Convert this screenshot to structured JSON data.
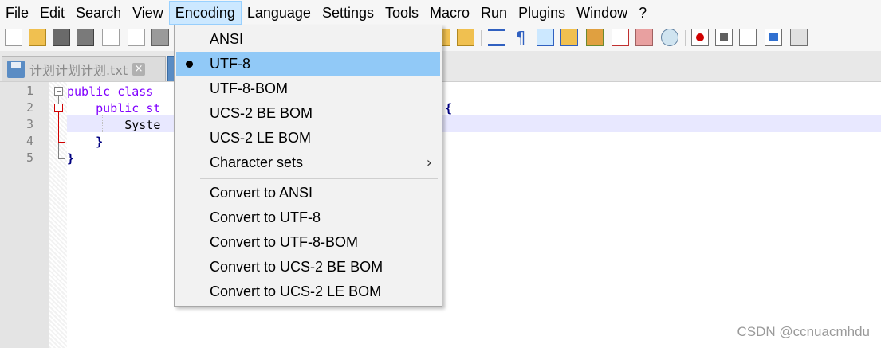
{
  "menubar": {
    "items": [
      "File",
      "Edit",
      "Search",
      "View",
      "Encoding",
      "Language",
      "Settings",
      "Tools",
      "Macro",
      "Run",
      "Plugins",
      "Window",
      "?"
    ],
    "active_index": 4
  },
  "tabs": [
    {
      "label": "计划计划计划.txt",
      "active": false
    }
  ],
  "editor": {
    "line_numbers": [
      "1",
      "2",
      "3",
      "4",
      "5"
    ],
    "lines": [
      {
        "kw": "public class",
        "rest": ""
      },
      {
        "indent": "    ",
        "kw": "public st",
        "rest": "",
        "bracket_tail": "{"
      },
      {
        "indent": "        ",
        "kw": "",
        "rest": "Syste"
      },
      {
        "indent": "    ",
        "kw": "",
        "rest": "",
        "bracket": "}"
      },
      {
        "indent": "",
        "kw": "",
        "rest": "",
        "bracket": "}"
      }
    ],
    "current_line": 3
  },
  "encoding_menu": {
    "items": [
      {
        "label": "ANSI",
        "checked": false
      },
      {
        "label": "UTF-8",
        "checked": true
      },
      {
        "label": "UTF-8-BOM",
        "checked": false
      },
      {
        "label": "UCS-2 BE BOM",
        "checked": false
      },
      {
        "label": "UCS-2 LE BOM",
        "checked": false
      },
      {
        "label": "Character sets",
        "checked": false,
        "submenu_glyph": "›"
      }
    ],
    "convert_items": [
      {
        "label": "Convert to ANSI"
      },
      {
        "label": "Convert to UTF-8"
      },
      {
        "label": "Convert to UTF-8-BOM"
      },
      {
        "label": "Convert to UCS-2 BE BOM"
      },
      {
        "label": "Convert to UCS-2 LE BOM"
      }
    ]
  },
  "watermark": "CSDN @ccnuacmhdu",
  "colors": {
    "selected_item": "#91c9f7",
    "active_menu": "#cce8ff",
    "keyword": "#8000ff",
    "current_line": "#e8e8ff"
  }
}
